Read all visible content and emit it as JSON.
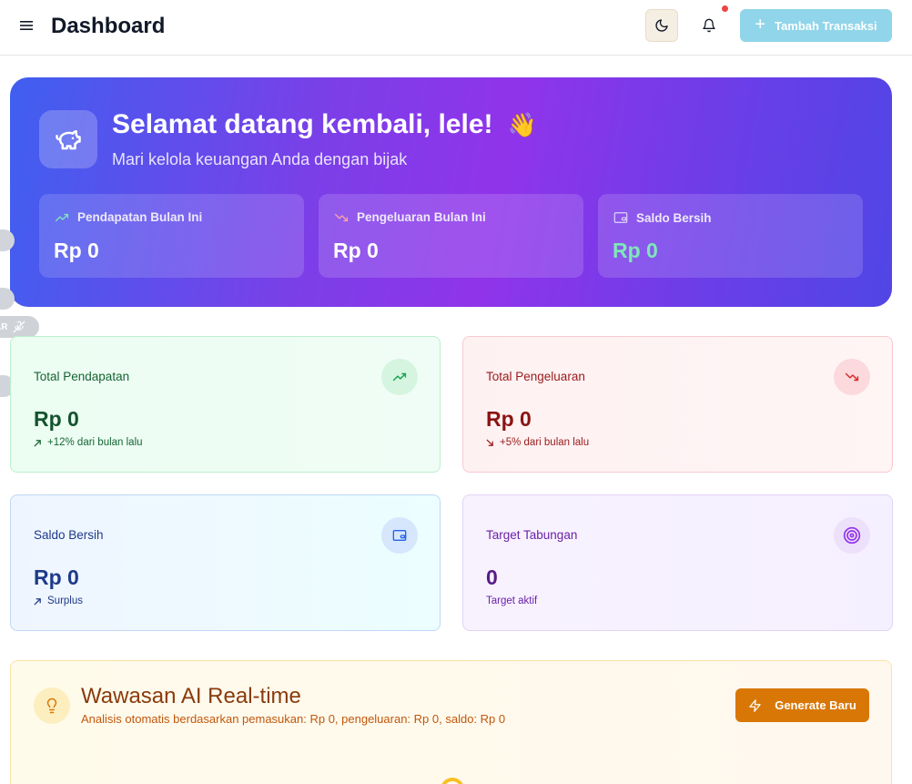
{
  "header": {
    "title": "Dashboard",
    "add_label": "Tambah Transaksi",
    "icons": [
      "menu-icon",
      "moon-icon",
      "bell-icon",
      "plus-icon"
    ],
    "notification_dot_color": "#ef4444"
  },
  "hero": {
    "title": "Selamat datang kembali, lele!",
    "emoji": "👋",
    "subtitle": "Mari kelola keuangan Anda dengan bijak",
    "icon": "piggy-bank-icon",
    "stats": [
      {
        "label": "Pendapatan Bulan Ini",
        "value": "Rp 0",
        "icon": "trending-up-icon"
      },
      {
        "label": "Pengeluaran Bulan Ini",
        "value": "Rp 0",
        "icon": "trending-down-icon"
      },
      {
        "label": "Saldo Bersih",
        "value": "Rp 0",
        "icon": "wallet-icon"
      }
    ]
  },
  "edge": {
    "pill_text": "AR"
  },
  "cards": [
    {
      "label": "Total Pendapatan",
      "value": "Rp 0",
      "sub": "+12% dari bulan lalu",
      "icon": "trending-up-icon",
      "accent": "#16a34a"
    },
    {
      "label": "Total Pengeluaran",
      "value": "Rp 0",
      "sub": "+5% dari bulan lalu",
      "icon": "trending-down-icon",
      "accent": "#dc2626"
    },
    {
      "label": "Saldo Bersih",
      "value": "Rp 0",
      "sub": "Surplus",
      "icon": "wallet-icon",
      "accent": "#2563eb"
    },
    {
      "label": "Target Tabungan",
      "value": "0",
      "sub": "Target aktif",
      "icon": "target-icon",
      "accent": "#9333ea"
    }
  ],
  "ai": {
    "title": "Wawasan AI Real-time",
    "subtitle": "Analisis otomatis berdasarkan pemasukan: Rp 0, pengeluaran: Rp 0, saldo: Rp 0",
    "button_label": "Generate Baru",
    "icon": "lightbulb-icon",
    "button_icon": "zap-icon",
    "accent": "#d97706"
  }
}
